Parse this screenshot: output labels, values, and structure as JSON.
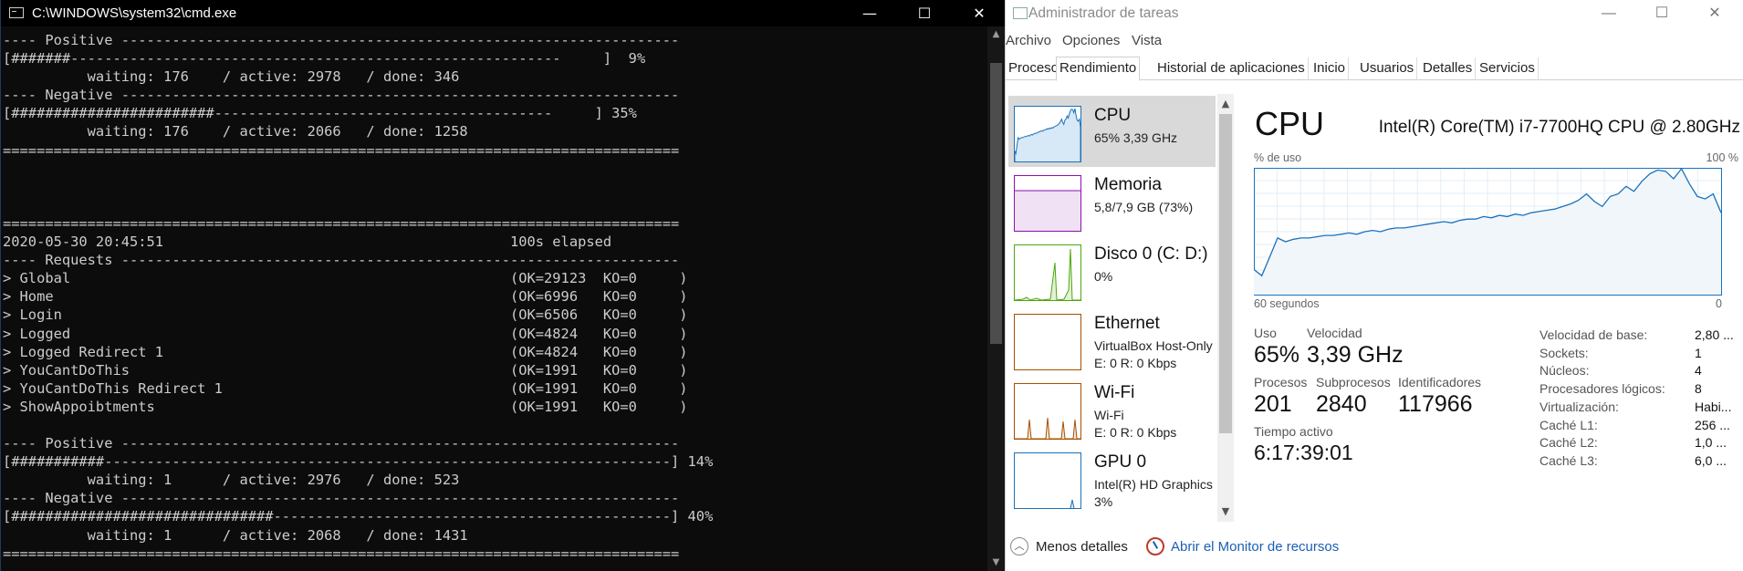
{
  "cmd": {
    "title": "C:\\WINDOWS\\system32\\cmd.exe",
    "minimize": "—",
    "maximize": "☐",
    "close": "✕",
    "lines": [
      "---- Positive ------------------------------------------------------------------",
      "[#######----------------------------------------------------------     ]  9%",
      "          waiting: 176    / active: 2978   / done: 346",
      "---- Negative ------------------------------------------------------------------",
      "[########################----------------------------------------     ] 35%",
      "          waiting: 176    / active: 2066   / done: 1258",
      "================================================================================",
      "",
      "",
      "",
      "================================================================================",
      "2020-05-30 20:45:51                                         100s elapsed",
      "---- Requests ------------------------------------------------------------------",
      "> Global                                                    (OK=29123  KO=0     )",
      "> Home                                                      (OK=6996   KO=0     )",
      "> Login                                                     (OK=6506   KO=0     )",
      "> Logged                                                    (OK=4824   KO=0     )",
      "> Logged Redirect 1                                         (OK=4824   KO=0     )",
      "> YouCantDoThis                                             (OK=1991   KO=0     )",
      "> YouCantDoThis Redirect 1                                  (OK=1991   KO=0     )",
      "> ShowAppoibtments                                          (OK=1991   KO=0     )",
      "",
      "---- Positive ------------------------------------------------------------------",
      "[###########-------------------------------------------------------------------] 14%",
      "          waiting: 1      / active: 2976   / done: 523",
      "---- Negative ------------------------------------------------------------------",
      "[###############################-----------------------------------------------] 40%",
      "          waiting: 1      / active: 2068   / done: 1431",
      "================================================================================"
    ]
  },
  "taskmgr": {
    "title": "Administrador de tareas",
    "minimize": "—",
    "maximize": "☐",
    "close": "✕",
    "menu": [
      "Archivo",
      "Opciones",
      "Vista"
    ],
    "tabs": [
      "Procesos",
      "Rendimiento",
      "Historial de aplicaciones",
      "Inicio",
      "Usuarios",
      "Detalles",
      "Servicios"
    ],
    "active_tab": "Rendimiento",
    "side": [
      {
        "name": "CPU",
        "sub": "65%  3,39 GHz",
        "sub2": "",
        "color": "#1a72bb"
      },
      {
        "name": "Memoria",
        "sub": "5,8/7,9 GB (73%)",
        "sub2": "",
        "color": "#8b12ae"
      },
      {
        "name": "Disco 0 (C: D:)",
        "sub": "0%",
        "sub2": "",
        "color": "#4da60c"
      },
      {
        "name": "Ethernet",
        "sub": "VirtualBox Host-Only",
        "sub2": "E: 0  R: 0 Kbps",
        "color": "#a74f01"
      },
      {
        "name": "Wi-Fi",
        "sub": "Wi-Fi",
        "sub2": "E: 0  R: 0 Kbps",
        "color": "#a74f01"
      },
      {
        "name": "GPU 0",
        "sub": "Intel(R) HD Graphics",
        "sub2": "3%",
        "color": "#1a72bb"
      }
    ],
    "main": {
      "title": "CPU",
      "model": "Intel(R) Core(TM) i7-7700HQ CPU @ 2.80GHz",
      "graph_label_left": "% de uso",
      "graph_label_right": "100 %",
      "graph_bottom_left": "60 segundos",
      "graph_bottom_right": "0",
      "usage_series": [
        20,
        15,
        30,
        45,
        42,
        44,
        45,
        45,
        46,
        47,
        47,
        48,
        49,
        48,
        50,
        51,
        50,
        52,
        53,
        53,
        54,
        55,
        56,
        57,
        58,
        57,
        59,
        60,
        60,
        62,
        61,
        63,
        62,
        64,
        63,
        65,
        66,
        67,
        68,
        70,
        72,
        75,
        80,
        74,
        70,
        78,
        80,
        86,
        82,
        90,
        96,
        99,
        98,
        92,
        100,
        88,
        78,
        76,
        80,
        65
      ],
      "stats": {
        "uso_label": "Uso",
        "uso_value": "65%",
        "velocidad_label": "Velocidad",
        "velocidad_value": "3,39 GHz",
        "procesos_label": "Procesos",
        "procesos_value": "201",
        "subprocesos_label": "Subprocesos",
        "subprocesos_value": "2840",
        "identificadores_label": "Identificadores",
        "identificadores_value": "117966",
        "tiempo_label": "Tiempo activo",
        "tiempo_value": "6:17:39:01"
      },
      "details": [
        {
          "k": "Velocidad de base:",
          "v": "2,80 ..."
        },
        {
          "k": "Sockets:",
          "v": "1"
        },
        {
          "k": "Núcleos:",
          "v": "4"
        },
        {
          "k": "Procesadores lógicos:",
          "v": "8"
        },
        {
          "k": "Virtualización:",
          "v": "Habi..."
        },
        {
          "k": "Caché L1:",
          "v": "256 ..."
        },
        {
          "k": "Caché L2:",
          "v": "1,0 ..."
        },
        {
          "k": "Caché L3:",
          "v": "6,0 ..."
        }
      ]
    },
    "footer": {
      "less": "Menos detalles",
      "monitor": "Abrir el Monitor de recursos"
    }
  }
}
